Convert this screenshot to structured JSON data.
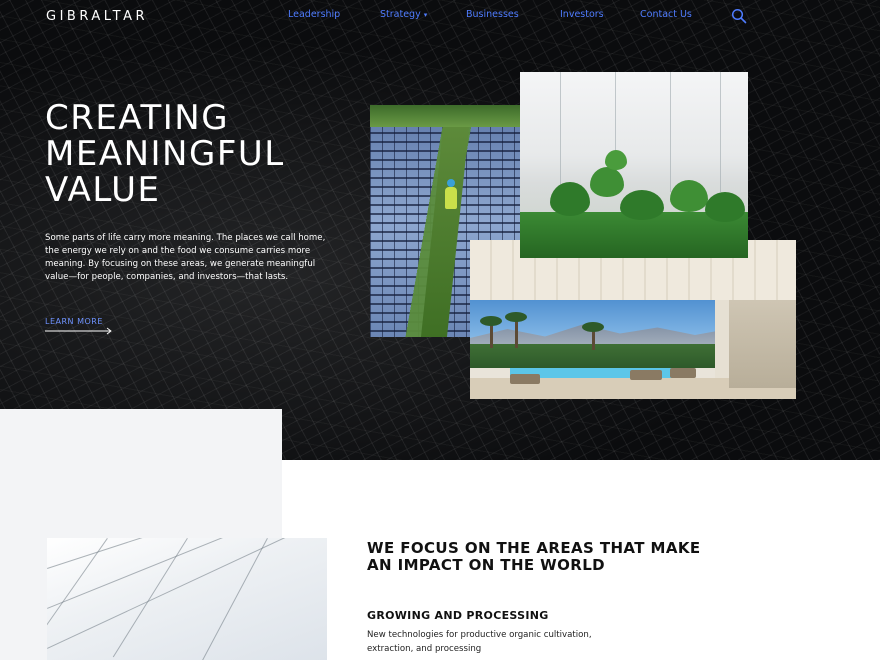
{
  "brand": {
    "logo_text": "GIBRALTAR"
  },
  "nav": {
    "items": [
      {
        "label": "Leadership",
        "has_dropdown": false
      },
      {
        "label": "Strategy",
        "has_dropdown": true
      },
      {
        "label": "Businesses",
        "has_dropdown": false
      },
      {
        "label": "Investors",
        "has_dropdown": false
      },
      {
        "label": "Contact Us",
        "has_dropdown": false
      }
    ],
    "caret": "▾",
    "search_icon": "search-icon",
    "link_color": "#4f7cff"
  },
  "hero": {
    "title_lines": [
      "CREATING",
      "MEANINGFUL",
      "VALUE"
    ],
    "body": "Some parts of life carry more meaning. The places we call home, the energy we rely on and the food we consume carries more meaning. By focusing on these areas, we generate meaningful value—for people, companies, and investors—that lasts.",
    "cta_label": "LEARN MORE",
    "images": [
      "solar-panels-image",
      "greenhouse-plants-image",
      "patio-pool-image"
    ]
  },
  "focus": {
    "title_lines": [
      "WE FOCUS ON THE AREAS THAT MAKE",
      "AN IMPACT ON THE WORLD"
    ],
    "subheading": "GROWING AND PROCESSING",
    "description_lines": [
      "New technologies for productive organic cultivation,",
      "extraction, and processing"
    ],
    "image": "glass-roof-image"
  },
  "colors": {
    "hero_bg": "#0b0c0e",
    "accent": "#4f7cff",
    "panel_grey": "#f3f4f6"
  }
}
